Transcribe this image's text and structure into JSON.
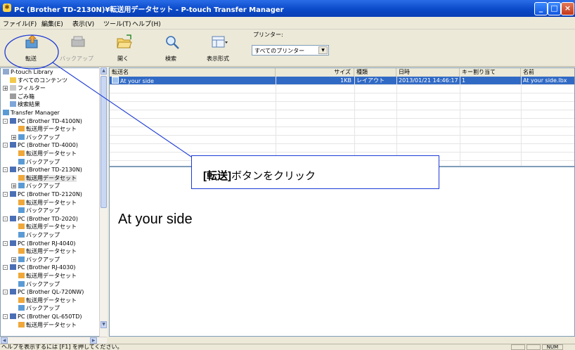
{
  "window": {
    "title": "PC (Brother TD-2130N)¥転送用データセット - P-touch Transfer Manager",
    "controls": [
      "_",
      "□",
      "×"
    ]
  },
  "menubar": [
    "ファイル(F)",
    "編集(E)",
    "表示(V)",
    "ツール(T)",
    "ヘルプ(H)"
  ],
  "toolbar": {
    "transfer": "転送",
    "backup": "バックアップ",
    "open": "開く",
    "search": "検索",
    "view_format": "表示形式",
    "printer_label": "プリンター:",
    "printer_value": "すべてのプリンター"
  },
  "tree": [
    {
      "label": "P-touch Library",
      "level": 0,
      "icon": "library-icon"
    },
    {
      "label": "すべてのコンテンツ",
      "level": 1,
      "icon": "folder-icon"
    },
    {
      "label": "フィルター",
      "level": 1,
      "icon": "filter-icon",
      "expander": "+"
    },
    {
      "label": "ごみ箱",
      "level": 1,
      "icon": "trash-icon"
    },
    {
      "label": "検索結果",
      "level": 1,
      "icon": "search-icon"
    },
    {
      "label": "Transfer Manager",
      "level": 0,
      "icon": "transfer-manager-icon"
    },
    {
      "label": "PC (Brother TD-4100N)",
      "level": 1,
      "icon": "printer-icon",
      "expander": "-"
    },
    {
      "label": "転送用データセット",
      "level": 2,
      "icon": "dataset-icon"
    },
    {
      "label": "バックアップ",
      "level": 2,
      "icon": "backup-folder-icon",
      "expander": "+"
    },
    {
      "label": "PC (Brother TD-4000)",
      "level": 1,
      "icon": "printer-icon",
      "expander": "-"
    },
    {
      "label": "転送用データセット",
      "level": 2,
      "icon": "dataset-icon"
    },
    {
      "label": "バックアップ",
      "level": 2,
      "icon": "backup-folder-icon"
    },
    {
      "label": "PC (Brother TD-2130N)",
      "level": 1,
      "icon": "printer-icon",
      "expander": "-"
    },
    {
      "label": "転送用データセット",
      "level": 2,
      "icon": "dataset-icon",
      "selected": true
    },
    {
      "label": "バックアップ",
      "level": 2,
      "icon": "backup-folder-icon",
      "expander": "+"
    },
    {
      "label": "PC (Brother TD-2120N)",
      "level": 1,
      "icon": "printer-icon",
      "expander": "-"
    },
    {
      "label": "転送用データセット",
      "level": 2,
      "icon": "dataset-icon"
    },
    {
      "label": "バックアップ",
      "level": 2,
      "icon": "backup-folder-icon"
    },
    {
      "label": "PC (Brother TD-2020)",
      "level": 1,
      "icon": "printer-icon",
      "expander": "-"
    },
    {
      "label": "転送用データセット",
      "level": 2,
      "icon": "dataset-icon"
    },
    {
      "label": "バックアップ",
      "level": 2,
      "icon": "backup-folder-icon"
    },
    {
      "label": "PC (Brother RJ-4040)",
      "level": 1,
      "icon": "printer-icon",
      "expander": "-"
    },
    {
      "label": "転送用データセット",
      "level": 2,
      "icon": "dataset-icon"
    },
    {
      "label": "バックアップ",
      "level": 2,
      "icon": "backup-folder-icon",
      "expander": "+"
    },
    {
      "label": "PC (Brother RJ-4030)",
      "level": 1,
      "icon": "printer-icon",
      "expander": "-"
    },
    {
      "label": "転送用データセット",
      "level": 2,
      "icon": "dataset-icon"
    },
    {
      "label": "バックアップ",
      "level": 2,
      "icon": "backup-folder-icon"
    },
    {
      "label": "PC (Brother QL-720NW)",
      "level": 1,
      "icon": "printer-icon",
      "expander": "-"
    },
    {
      "label": "転送用データセット",
      "level": 2,
      "icon": "dataset-icon"
    },
    {
      "label": "バックアップ",
      "level": 2,
      "icon": "backup-folder-icon"
    },
    {
      "label": "PC (Brother QL-650TD)",
      "level": 1,
      "icon": "printer-icon",
      "expander": "-"
    },
    {
      "label": "転送用データセット",
      "level": 2,
      "icon": "dataset-icon"
    }
  ],
  "table": {
    "columns": [
      "転送名",
      "サイズ",
      "種類",
      "日時",
      "キー割り当て",
      "名前"
    ],
    "rows": [
      {
        "name": "At your side",
        "size": "1KB",
        "type": "レイアウト",
        "datetime": "2013/01/21 14:46:17",
        "key": "1",
        "filename": "At your side.lbx"
      }
    ]
  },
  "preview": {
    "text": "At your side"
  },
  "callout": {
    "prefix": "[転送]",
    "text": "ボタンをクリック"
  },
  "status": {
    "text": "ヘルプを表示するには [F1] を押してください。",
    "num": "NUM"
  },
  "colors": {
    "selection": "#316ac5",
    "annotation": "#1e3bd6"
  }
}
